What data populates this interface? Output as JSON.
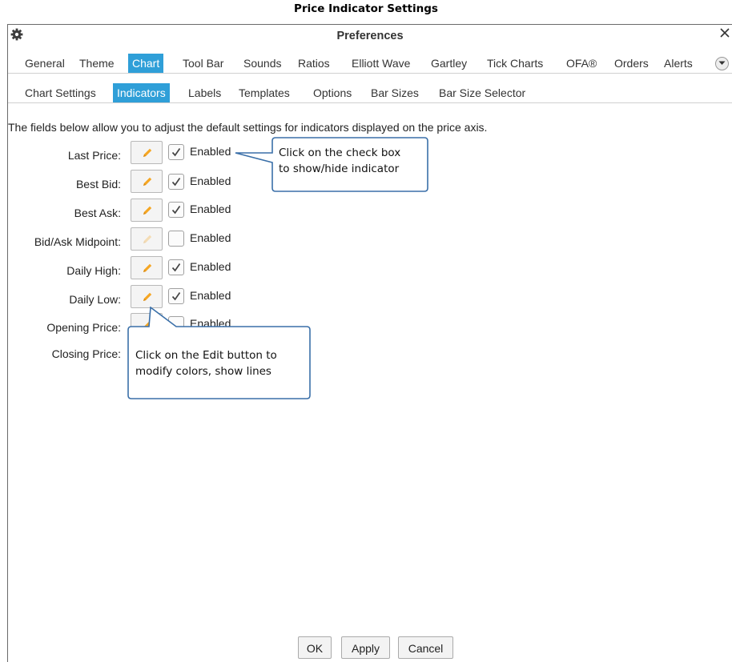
{
  "doc_title": "Price Indicator Settings",
  "window": {
    "title": "Preferences",
    "close_glyph": "✕",
    "gear_glyph": "✿"
  },
  "main_tabs": [
    {
      "label": "General"
    },
    {
      "label": "Theme"
    },
    {
      "label": "Chart",
      "active": true
    },
    {
      "label": "Tool Bar"
    },
    {
      "label": "Sounds"
    },
    {
      "label": "Ratios"
    },
    {
      "label": "Elliott Wave"
    },
    {
      "label": "Gartley"
    },
    {
      "label": "Tick Charts"
    },
    {
      "label": "OFA®"
    },
    {
      "label": "Orders"
    },
    {
      "label": "Alerts"
    }
  ],
  "sub_tabs": [
    {
      "label": "Chart Settings"
    },
    {
      "label": "Indicators",
      "active": true
    },
    {
      "label": "Labels"
    },
    {
      "label": "Templates"
    },
    {
      "label": "Options"
    },
    {
      "label": "Bar Sizes"
    },
    {
      "label": "Bar Size Selector"
    }
  ],
  "description": "The fields below allow you to adjust the default settings for indicators displayed on the price axis.",
  "indicators": [
    {
      "label": "Last Price:",
      "enabled": true,
      "enabled_label": "Enabled"
    },
    {
      "label": "Best Bid:",
      "enabled": true,
      "enabled_label": "Enabled"
    },
    {
      "label": "Best Ask:",
      "enabled": true,
      "enabled_label": "Enabled"
    },
    {
      "label": "Bid/Ask Midpoint:",
      "enabled": false,
      "enabled_label": "Enabled"
    },
    {
      "label": "Daily High:",
      "enabled": true,
      "enabled_label": "Enabled"
    },
    {
      "label": "Daily Low:",
      "enabled": true,
      "enabled_label": "Enabled"
    },
    {
      "label": "Opening Price:",
      "enabled": false,
      "enabled_label": "Enabled"
    },
    {
      "label": "Closing Price:"
    }
  ],
  "callouts": {
    "checkbox": {
      "line1": "Click on the check box",
      "line2": "to show/hide indicator"
    },
    "edit": {
      "line1": "Click on the Edit button to",
      "line2": "modify colors, show lines"
    }
  },
  "buttons": {
    "ok": "OK",
    "apply": "Apply",
    "cancel": "Cancel"
  },
  "colors": {
    "accent": "#2f9fd8",
    "pencil": "#f5a623",
    "callout_border": "#3a6fa8"
  }
}
